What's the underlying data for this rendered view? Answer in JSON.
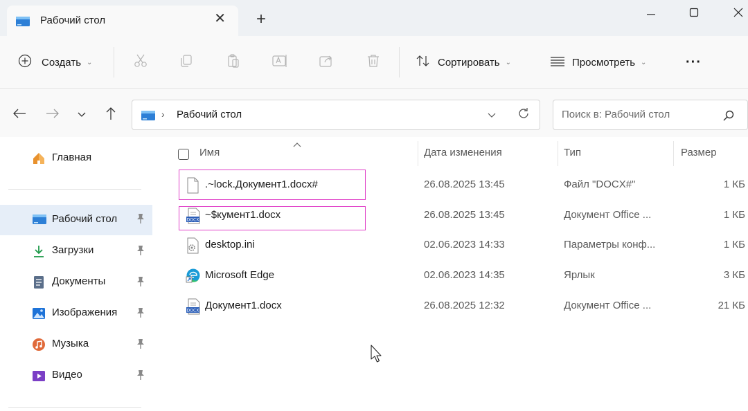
{
  "window": {
    "tab_title": "Рабочий стол",
    "tab_close": "✕",
    "tab_add": "+"
  },
  "toolbar": {
    "create_label": "Создать",
    "sort_label": "Сортировать",
    "view_label": "Просмотреть",
    "more_label": "···"
  },
  "address": {
    "path": "Рабочий стол",
    "separator": "›"
  },
  "search": {
    "placeholder": "Поиск в: Рабочий стол"
  },
  "sidebar": {
    "home": "Главная",
    "items": [
      {
        "label": "Рабочий стол",
        "icon": "desktop-folder-icon",
        "selected": true
      },
      {
        "label": "Загрузки",
        "icon": "downloads-icon"
      },
      {
        "label": "Документы",
        "icon": "documents-icon"
      },
      {
        "label": "Изображения",
        "icon": "pictures-icon"
      },
      {
        "label": "Музыка",
        "icon": "music-icon"
      },
      {
        "label": "Видео",
        "icon": "videos-icon"
      }
    ]
  },
  "columns": {
    "name": "Имя",
    "date": "Дата изменения",
    "type": "Тип",
    "size": "Размер"
  },
  "files": [
    {
      "name": ".~lock.Документ1.docx#",
      "date": "26.08.2025 13:45",
      "type": "Файл \"DOCX#\"",
      "size": "1 КБ",
      "icon": "blank-file-icon",
      "highlighted": true
    },
    {
      "name": "~$кумент1.docx",
      "date": "26.08.2025 13:45",
      "type": "Документ Office ...",
      "size": "1 КБ",
      "icon": "docx-file-icon",
      "highlighted": true
    },
    {
      "name": "desktop.ini",
      "date": "02.06.2023 14:33",
      "type": "Параметры конф...",
      "size": "1 КБ",
      "icon": "settings-file-icon"
    },
    {
      "name": "Microsoft Edge",
      "date": "02.06.2023 14:35",
      "type": "Ярлык",
      "size": "3 КБ",
      "icon": "edge-shortcut-icon"
    },
    {
      "name": "Документ1.docx",
      "date": "26.08.2025 12:32",
      "type": "Документ Office ...",
      "size": "21 КБ",
      "icon": "docx-file-icon"
    }
  ],
  "colors": {
    "accent": "#0067c0",
    "highlight_box": "#e040c8",
    "selected_bg": "#e6eef8"
  }
}
